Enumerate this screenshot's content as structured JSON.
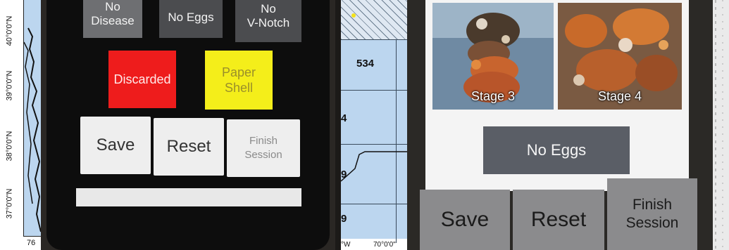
{
  "left_map": {
    "lat_labels": [
      "40°0'0\"N",
      "39°0'0\"N",
      "38°0'0\"N",
      "37°0'0\"N"
    ],
    "bottom_label": "76"
  },
  "phone_1": {
    "top_buttons": [
      {
        "label": "No\nDisease"
      },
      {
        "label": "No Eggs"
      },
      {
        "label": "No\nV-Notch"
      }
    ],
    "discarded_label": "Discarded",
    "paper_shell_label": "Paper\nShell",
    "save_label": "Save",
    "reset_label": "Reset",
    "finish_label": "Finish\nSession",
    "colors": {
      "discarded": "#ee1c1c",
      "paper_shell": "#f4ee1a"
    }
  },
  "mid_map": {
    "area_top": "534",
    "area_partial_1": "4",
    "area_partial_2": "9",
    "area_partial_3": "9",
    "bottom_left": "°W",
    "bottom_right": "70°0'0\""
  },
  "phone_2": {
    "stage_3_label": "Stage 3",
    "stage_4_label": "Stage 4",
    "no_eggs_label": "No Eggs",
    "save_label": "Save",
    "reset_label": "Reset",
    "finish_label": "Finish\nSession"
  }
}
